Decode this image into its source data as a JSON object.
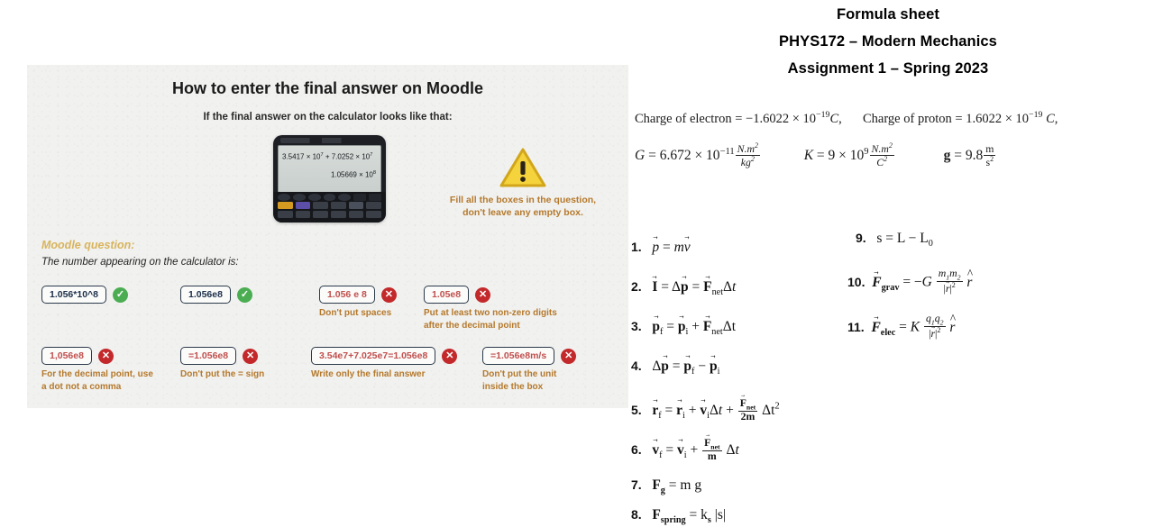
{
  "formula_sheet": {
    "title_line_1": "Formula sheet",
    "title_line_2": "PHYS172 – Modern Mechanics",
    "title_line_3": "Assignment 1 – Spring 2023",
    "constants": [
      {
        "id": "charge-of-electron",
        "label": "Charge of electron",
        "value": "−1.6022 × 10⁻¹⁹",
        "unit": "C"
      },
      {
        "id": "charge-of-proton",
        "label": "Charge of proton",
        "value": "1.6022 × 10⁻¹⁹",
        "unit": "C"
      },
      {
        "id": "gravitational-constant",
        "label": "G",
        "value": "6.672 × 10⁻¹¹",
        "unit": "N.m²/kg²"
      },
      {
        "id": "coulomb-constant",
        "label": "K",
        "value": "9 × 10⁹",
        "unit": "N.m²/C²"
      },
      {
        "id": "gravitational-acceleration",
        "label": "g",
        "value": "9.8",
        "unit": "m/s²"
      }
    ],
    "formulas_left": [
      {
        "number": "1.",
        "text": "p⃗ = m v⃗"
      },
      {
        "number": "2.",
        "text": "I⃗ = Δp⃗ = F⃗net Δt"
      },
      {
        "number": "3.",
        "text": "p⃗f = p⃗i + F⃗net Δt"
      },
      {
        "number": "4.",
        "text": "Δp⃗ = p⃗f − p⃗i"
      },
      {
        "number": "5.",
        "text": "r⃗f = r⃗i + v⃗i Δt + (F⃗net / 2m) Δt²"
      },
      {
        "number": "6.",
        "text": "v⃗f = v⃗i + (F⃗net / m) Δt"
      },
      {
        "number": "7.",
        "text": "Fg = m g"
      },
      {
        "number": "8.",
        "text": "Fspring = ks |s|"
      }
    ],
    "formulas_right": [
      {
        "number": "9.",
        "text": "s = L − L0"
      },
      {
        "number": "10.",
        "text": "F⃗grav = −G (m1 m2 / |r⃗|²) r̂"
      },
      {
        "number": "11.",
        "text": "F⃗elec = K (q1 q2 / |r⃗|²) r̂"
      }
    ]
  },
  "infographic": {
    "heading": "How to enter the final answer on Moodle",
    "subheading": "If the final answer on the calculator looks like that:",
    "calculator": {
      "line_1_base_a": "3.5417 × 10",
      "line_1_exp_a": "7",
      "line_1_op": " + 7.0252 × 10",
      "line_1_exp_b": "7",
      "line_2_base": "1.05669 × 10",
      "line_2_exp": "8"
    },
    "warning": {
      "icon": "warning-triangle-icon",
      "text_line_1": "Fill all the boxes in the question,",
      "text_line_2": "don't leave any empty box."
    },
    "moodle_label": "Moodle question:",
    "moodle_question": "The number appearing on the calculator is:",
    "answers": [
      {
        "id": "a1",
        "value": "1.056*10^8",
        "status": "correct",
        "mark": "✓",
        "note": ""
      },
      {
        "id": "a2",
        "value": "1.056e8",
        "status": "correct",
        "mark": "✓",
        "note": ""
      },
      {
        "id": "a3",
        "value": "1.056 e 8",
        "status": "incorrect",
        "mark": "✕",
        "note": "Don't put spaces"
      },
      {
        "id": "a4",
        "value": "1.05e8",
        "status": "incorrect",
        "mark": "✕",
        "note": "Put at least two non-zero digits after the decimal point"
      },
      {
        "id": "a5",
        "value": "1,056e8",
        "status": "incorrect",
        "mark": "✕",
        "note": "For the decimal point, use a dot not a comma"
      },
      {
        "id": "a6",
        "value": "=1.056e8",
        "status": "incorrect",
        "mark": "✕",
        "note": "Don't put the = sign"
      },
      {
        "id": "a7",
        "value": "3.54e7+7.025e7=1.056e8",
        "status": "incorrect",
        "mark": "✕",
        "note": "Write only the final answer"
      },
      {
        "id": "a8",
        "value": "=1.056e8m/s",
        "status": "incorrect",
        "mark": "✕",
        "note": "Don't put the unit inside the box"
      }
    ]
  },
  "colors": {
    "correct_green": "#4bad52",
    "incorrect_red": "#c3292b",
    "note_orange": "#b5792c",
    "moodle_label_gold": "#d8b45c",
    "box_border": "#2b3a4a",
    "panel_bg": "#f1f1ef"
  }
}
